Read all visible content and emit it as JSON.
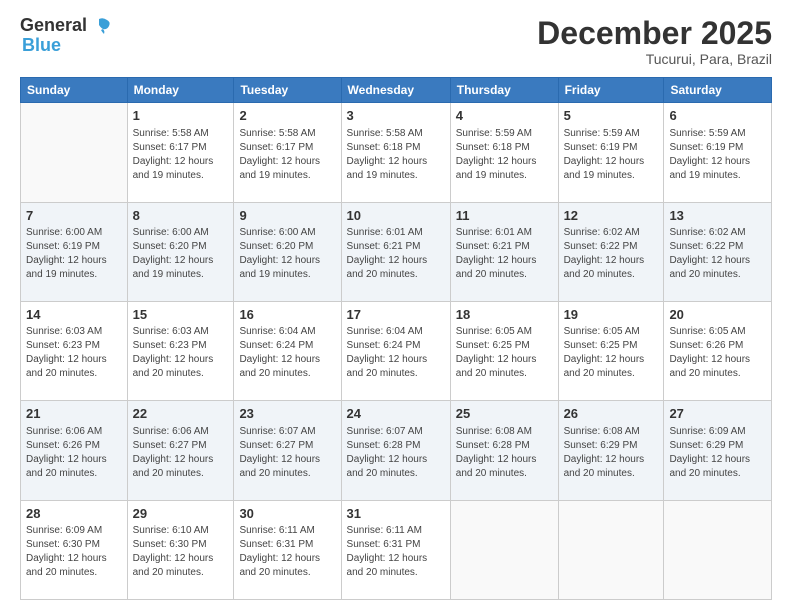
{
  "header": {
    "logo_general": "General",
    "logo_blue": "Blue",
    "month_title": "December 2025",
    "subtitle": "Tucurui, Para, Brazil"
  },
  "days_of_week": [
    "Sunday",
    "Monday",
    "Tuesday",
    "Wednesday",
    "Thursday",
    "Friday",
    "Saturday"
  ],
  "weeks": [
    [
      {
        "day": "",
        "empty": true
      },
      {
        "day": "1",
        "sunrise": "5:58 AM",
        "sunset": "6:17 PM",
        "daylight": "12 hours and 19 minutes."
      },
      {
        "day": "2",
        "sunrise": "5:58 AM",
        "sunset": "6:17 PM",
        "daylight": "12 hours and 19 minutes."
      },
      {
        "day": "3",
        "sunrise": "5:58 AM",
        "sunset": "6:18 PM",
        "daylight": "12 hours and 19 minutes."
      },
      {
        "day": "4",
        "sunrise": "5:59 AM",
        "sunset": "6:18 PM",
        "daylight": "12 hours and 19 minutes."
      },
      {
        "day": "5",
        "sunrise": "5:59 AM",
        "sunset": "6:19 PM",
        "daylight": "12 hours and 19 minutes."
      },
      {
        "day": "6",
        "sunrise": "5:59 AM",
        "sunset": "6:19 PM",
        "daylight": "12 hours and 19 minutes."
      }
    ],
    [
      {
        "day": "7",
        "sunrise": "6:00 AM",
        "sunset": "6:19 PM",
        "daylight": "12 hours and 19 minutes."
      },
      {
        "day": "8",
        "sunrise": "6:00 AM",
        "sunset": "6:20 PM",
        "daylight": "12 hours and 19 minutes."
      },
      {
        "day": "9",
        "sunrise": "6:00 AM",
        "sunset": "6:20 PM",
        "daylight": "12 hours and 19 minutes."
      },
      {
        "day": "10",
        "sunrise": "6:01 AM",
        "sunset": "6:21 PM",
        "daylight": "12 hours and 20 minutes."
      },
      {
        "day": "11",
        "sunrise": "6:01 AM",
        "sunset": "6:21 PM",
        "daylight": "12 hours and 20 minutes."
      },
      {
        "day": "12",
        "sunrise": "6:02 AM",
        "sunset": "6:22 PM",
        "daylight": "12 hours and 20 minutes."
      },
      {
        "day": "13",
        "sunrise": "6:02 AM",
        "sunset": "6:22 PM",
        "daylight": "12 hours and 20 minutes."
      }
    ],
    [
      {
        "day": "14",
        "sunrise": "6:03 AM",
        "sunset": "6:23 PM",
        "daylight": "12 hours and 20 minutes."
      },
      {
        "day": "15",
        "sunrise": "6:03 AM",
        "sunset": "6:23 PM",
        "daylight": "12 hours and 20 minutes."
      },
      {
        "day": "16",
        "sunrise": "6:04 AM",
        "sunset": "6:24 PM",
        "daylight": "12 hours and 20 minutes."
      },
      {
        "day": "17",
        "sunrise": "6:04 AM",
        "sunset": "6:24 PM",
        "daylight": "12 hours and 20 minutes."
      },
      {
        "day": "18",
        "sunrise": "6:05 AM",
        "sunset": "6:25 PM",
        "daylight": "12 hours and 20 minutes."
      },
      {
        "day": "19",
        "sunrise": "6:05 AM",
        "sunset": "6:25 PM",
        "daylight": "12 hours and 20 minutes."
      },
      {
        "day": "20",
        "sunrise": "6:05 AM",
        "sunset": "6:26 PM",
        "daylight": "12 hours and 20 minutes."
      }
    ],
    [
      {
        "day": "21",
        "sunrise": "6:06 AM",
        "sunset": "6:26 PM",
        "daylight": "12 hours and 20 minutes."
      },
      {
        "day": "22",
        "sunrise": "6:06 AM",
        "sunset": "6:27 PM",
        "daylight": "12 hours and 20 minutes."
      },
      {
        "day": "23",
        "sunrise": "6:07 AM",
        "sunset": "6:27 PM",
        "daylight": "12 hours and 20 minutes."
      },
      {
        "day": "24",
        "sunrise": "6:07 AM",
        "sunset": "6:28 PM",
        "daylight": "12 hours and 20 minutes."
      },
      {
        "day": "25",
        "sunrise": "6:08 AM",
        "sunset": "6:28 PM",
        "daylight": "12 hours and 20 minutes."
      },
      {
        "day": "26",
        "sunrise": "6:08 AM",
        "sunset": "6:29 PM",
        "daylight": "12 hours and 20 minutes."
      },
      {
        "day": "27",
        "sunrise": "6:09 AM",
        "sunset": "6:29 PM",
        "daylight": "12 hours and 20 minutes."
      }
    ],
    [
      {
        "day": "28",
        "sunrise": "6:09 AM",
        "sunset": "6:30 PM",
        "daylight": "12 hours and 20 minutes."
      },
      {
        "day": "29",
        "sunrise": "6:10 AM",
        "sunset": "6:30 PM",
        "daylight": "12 hours and 20 minutes."
      },
      {
        "day": "30",
        "sunrise": "6:11 AM",
        "sunset": "6:31 PM",
        "daylight": "12 hours and 20 minutes."
      },
      {
        "day": "31",
        "sunrise": "6:11 AM",
        "sunset": "6:31 PM",
        "daylight": "12 hours and 20 minutes."
      },
      {
        "day": "",
        "empty": true
      },
      {
        "day": "",
        "empty": true
      },
      {
        "day": "",
        "empty": true
      }
    ]
  ]
}
